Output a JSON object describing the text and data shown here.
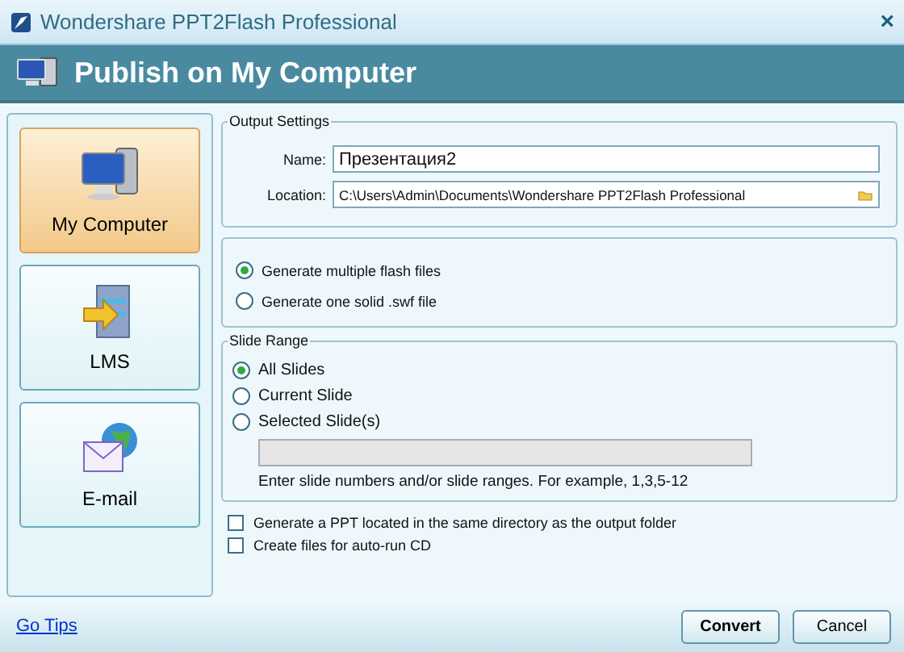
{
  "window": {
    "title": "Wondershare PPT2Flash Professional",
    "close": "×"
  },
  "header": {
    "title": "Publish on My Computer"
  },
  "sidebar": {
    "items": [
      {
        "label": "My Computer",
        "kind": "computer",
        "selected": true
      },
      {
        "label": "LMS",
        "kind": "lms",
        "selected": false
      },
      {
        "label": "E-mail",
        "kind": "email",
        "selected": false
      }
    ]
  },
  "output_settings": {
    "title": "Output Settings",
    "name_label": "Name:",
    "name_value": "Презентация2",
    "location_label": "Location:",
    "location_value": "C:\\Users\\Admin\\Documents\\Wondershare PPT2Flash Professional"
  },
  "output_mode": [
    {
      "label": "Generate multiple flash files",
      "selected": true
    },
    {
      "label": "Generate one solid .swf file",
      "selected": false
    }
  ],
  "slide_range": {
    "title": "Slide Range",
    "options": [
      {
        "label": "All Slides",
        "selected": true
      },
      {
        "label": "Current Slide",
        "selected": false
      },
      {
        "label": "Selected Slide(s)",
        "selected": false
      }
    ],
    "slides_field_disabled": true,
    "hint": "Enter slide numbers and/or slide ranges. For example, 1,3,5-12"
  },
  "options": [
    {
      "label": "Generate a PPT located in the same directory as the output folder",
      "checked": false
    },
    {
      "label": "Create files for auto-run CD",
      "checked": false
    }
  ],
  "footer": {
    "link": "Go Tips",
    "buttons": [
      "Convert",
      "Cancel"
    ]
  }
}
